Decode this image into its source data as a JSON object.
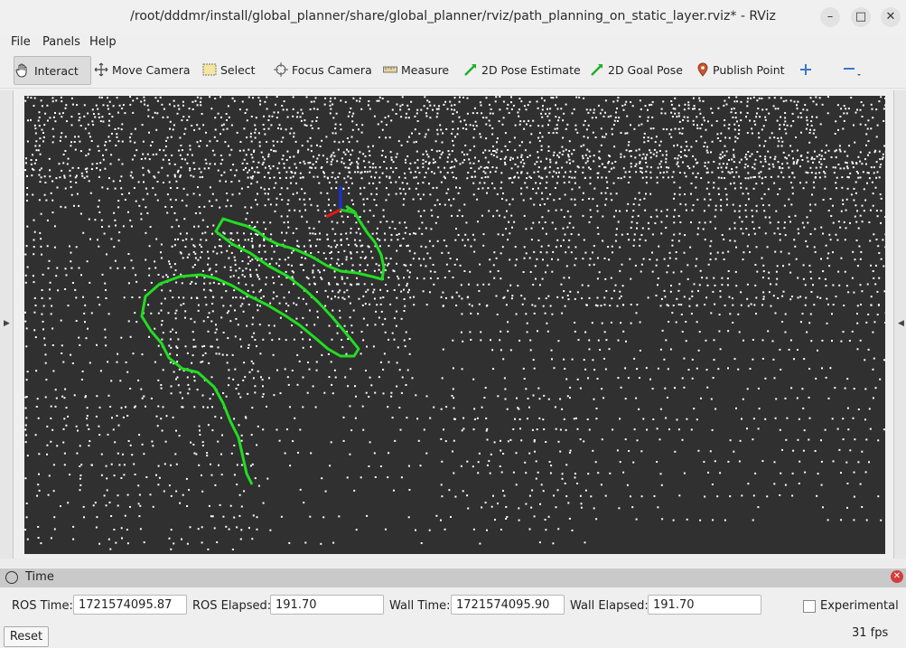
{
  "window": {
    "title": "/root/dddmr/install/global_planner/share/global_planner/rviz/path_planning_on_static_layer.rviz* - RViz",
    "minimize": "–",
    "maximize": "□",
    "close": "✕"
  },
  "menu": {
    "file": "File",
    "panels": "Panels",
    "help": "Help"
  },
  "toolbar": {
    "interact": "Interact",
    "move_camera": "Move Camera",
    "select": "Select",
    "focus_camera": "Focus Camera",
    "measure": "Measure",
    "pose_estimate": "2D Pose Estimate",
    "goal_pose": "2D Goal Pose",
    "publish_point": "Publish Point"
  },
  "time_panel": {
    "title": "Time",
    "ros_time_label": "ROS Time:",
    "ros_time": "1721574095.87",
    "ros_elapsed_label": "ROS Elapsed:",
    "ros_elapsed": "191.70",
    "wall_time_label": "Wall Time:",
    "wall_time": "1721574095.90",
    "wall_elapsed_label": "Wall Elapsed:",
    "wall_elapsed": "191.70",
    "experimental_label": "Experimental"
  },
  "status": {
    "reset": "Reset",
    "fps": "31 fps"
  },
  "colors": {
    "viewport_bg": "#303030",
    "path": "#22dd22",
    "points": "#ffffff"
  },
  "icons": {
    "interact": "hand-icon",
    "move_camera": "move-arrows-icon",
    "select": "selection-rect-icon",
    "focus_camera": "crosshair-icon",
    "measure": "ruler-icon",
    "pose_estimate": "green-arrow-icon",
    "goal_pose": "green-arrow-icon",
    "publish_point": "map-pin-icon",
    "add_tool": "plus-icon",
    "remove_tool": "minus-icon"
  }
}
